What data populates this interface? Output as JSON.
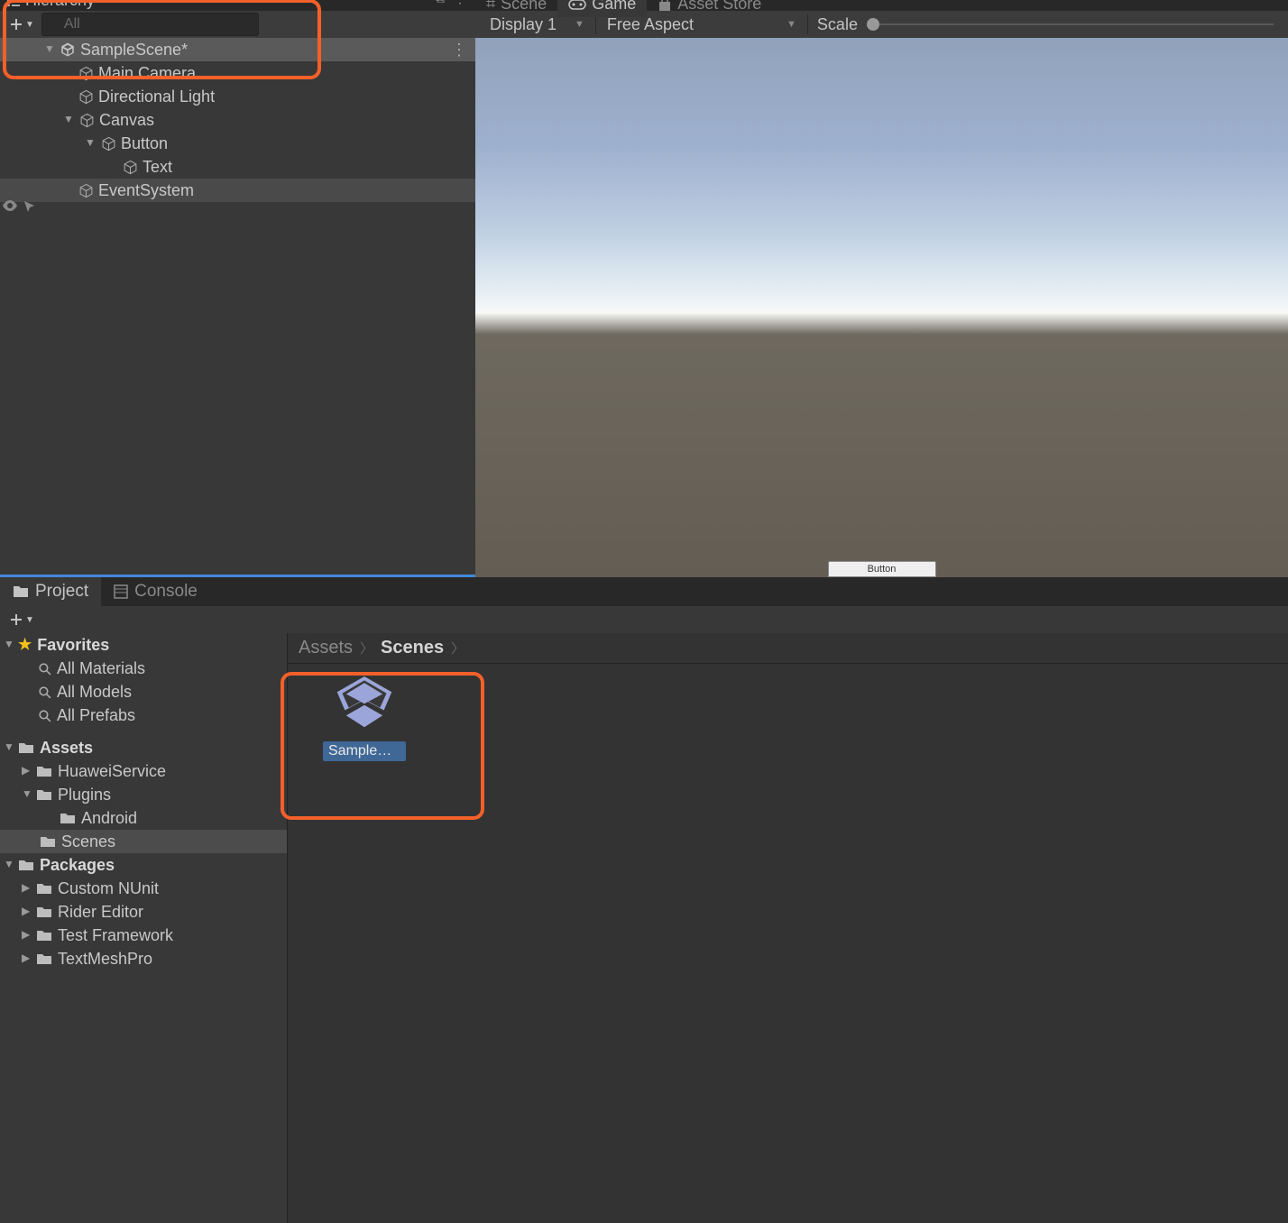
{
  "hierarchy": {
    "tab_label": "Hierarchy",
    "search_placeholder": "All",
    "scene": {
      "name": "SampleScene*",
      "objects": [
        {
          "name": "Main Camera",
          "indent": 85
        },
        {
          "name": "Directional Light",
          "indent": 85
        },
        {
          "name": "Canvas",
          "indent": 85,
          "expanded": true,
          "children": [
            {
              "name": "Button",
              "indent": 110,
              "expanded": true,
              "children": [
                {
                  "name": "Text",
                  "indent": 134
                }
              ]
            }
          ]
        },
        {
          "name": "EventSystem",
          "indent": 85
        }
      ]
    }
  },
  "scene_panel": {
    "tabs": {
      "scene": "Scene",
      "game": "Game",
      "asset_store": "Asset Store"
    },
    "display_dropdown": "Display 1",
    "aspect_dropdown": "Free Aspect",
    "scale_label": "Scale",
    "game_button_label": "Button"
  },
  "project": {
    "tabs": {
      "project": "Project",
      "console": "Console"
    },
    "tree": {
      "favorites": {
        "label": "Favorites",
        "items": [
          "All Materials",
          "All Models",
          "All Prefabs"
        ]
      },
      "assets": {
        "label": "Assets",
        "items": [
          {
            "name": "HuaweiService",
            "indent": 24,
            "expandable": true
          },
          {
            "name": "Plugins",
            "indent": 24,
            "expandable": true,
            "expanded": true,
            "children": [
              {
                "name": "Android",
                "indent": 66
              }
            ]
          },
          {
            "name": "Scenes",
            "indent": 44,
            "selected": true
          }
        ]
      },
      "packages": {
        "label": "Packages",
        "items": [
          {
            "name": "Custom NUnit",
            "indent": 24
          },
          {
            "name": "Rider Editor",
            "indent": 24
          },
          {
            "name": "Test Framework",
            "indent": 24
          },
          {
            "name": "TextMeshPro",
            "indent": 24
          }
        ]
      }
    },
    "breadcrumb": {
      "root": "Assets",
      "current": "Scenes"
    },
    "assets": [
      {
        "label": "SampleSc..."
      }
    ]
  }
}
